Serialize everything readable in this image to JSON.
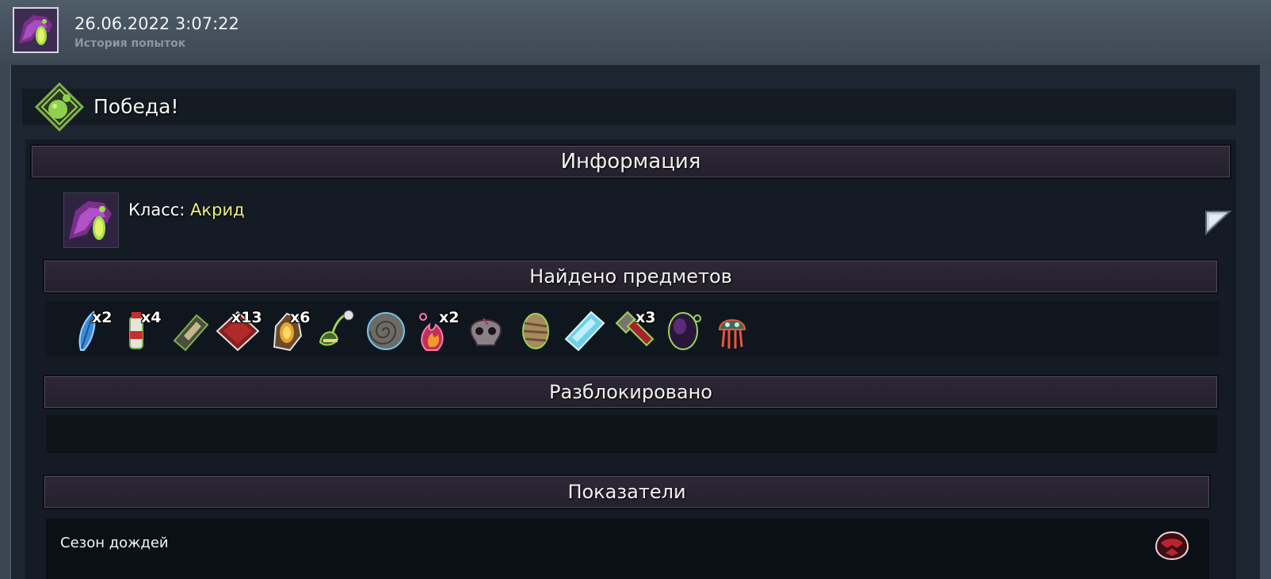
{
  "header": {
    "date": "26.06.2022 3:07:22",
    "subtitle": "История попыток"
  },
  "result": {
    "label": "Победа!"
  },
  "sections": {
    "info": "Информация",
    "items": "Найдено предметов",
    "unlocked": "Разблокировано",
    "stats": "Показатели"
  },
  "class": {
    "label": "Класс:",
    "value": "Акрид"
  },
  "items": [
    {
      "icon": "blue-feather-icon",
      "count": "x2"
    },
    {
      "icon": "energy-drink-icon",
      "count": "x4"
    },
    {
      "icon": "war-horn-icon",
      "count": ""
    },
    {
      "icon": "red-book-icon",
      "count": "x13"
    },
    {
      "icon": "amber-crystal-icon",
      "count": "x6"
    },
    {
      "icon": "venus-flytrap-icon",
      "count": ""
    },
    {
      "icon": "fossil-shell-icon",
      "count": ""
    },
    {
      "icon": "fire-spirit-icon",
      "count": "x2"
    },
    {
      "icon": "skull-icon",
      "count": ""
    },
    {
      "icon": "mummy-head-icon",
      "count": ""
    },
    {
      "icon": "ice-crystal-icon",
      "count": ""
    },
    {
      "icon": "red-hammer-icon",
      "count": "x3"
    },
    {
      "icon": "void-egg-icon",
      "count": ""
    },
    {
      "icon": "jellyfish-icon",
      "count": ""
    }
  ],
  "stats": {
    "difficulty_label": "Сезон дождей",
    "difficulty_icon": "monsoon-difficulty-icon"
  },
  "colors": {
    "class_name": "#ecec7a",
    "section_header": "#2e2838",
    "background": "#1d2630"
  }
}
